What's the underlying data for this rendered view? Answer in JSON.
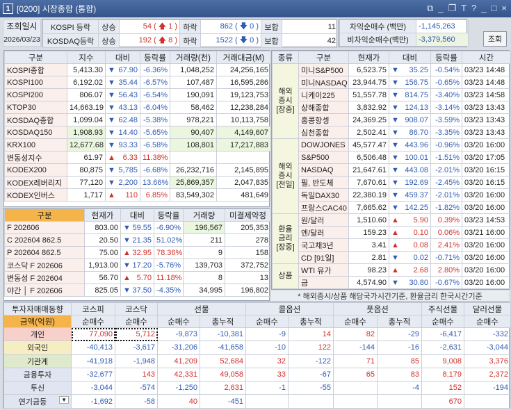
{
  "window": {
    "number": "1",
    "title": "[0200] 시장종합 (통합)",
    "icons": [
      "restore-icon",
      "minimize-icon",
      "copy-icon",
      "font-icon",
      "help-icon",
      "win-minimize-icon",
      "maximize-icon",
      "close-icon"
    ],
    "icon_glyphs": [
      "⧉",
      "_",
      "❐",
      "T",
      "?",
      "_",
      "□",
      "×"
    ]
  },
  "colors": {
    "up": "#d0312d",
    "down": "#2f5bb5",
    "header": "#e6ebf3",
    "orange": "#f5b44a",
    "title_bar": "#34538a"
  },
  "top": {
    "date_label": "조회일시",
    "date": "2026/03/23",
    "breadth": [
      {
        "market": "KOSPI 등락",
        "up_label": "상승",
        "up": "54",
        "up_chg": "1",
        "down_label": "하락",
        "down": "862",
        "down_chg": "0",
        "flat_label": "보합",
        "flat": "11"
      },
      {
        "market": "KOSDAQ등락",
        "up_label": "상승",
        "up": "192",
        "up_chg": "8",
        "down_label": "하락",
        "down": "1522",
        "down_chg": "0",
        "flat_label": "보합",
        "flat": "42"
      }
    ],
    "arbitrage": [
      {
        "label": "차익순매수  (백만)",
        "value": "-1,145,263"
      },
      {
        "label": "비차익순매수(백만)",
        "value": "-3,379,560"
      }
    ],
    "query_button": "조회"
  },
  "index_table": {
    "headers": [
      "구분",
      "지수",
      "대비",
      "등락률",
      "거래량(천)",
      "거래대금(M)"
    ],
    "rows": [
      {
        "name": "KOSPI종합",
        "value": "5,413.30",
        "dir": "dn",
        "chg": "67.90",
        "rate": "-6.36%",
        "vol": "1,048,252",
        "amt": "24,256,165"
      },
      {
        "name": "KOSPI100",
        "value": "6,192.02",
        "dir": "dn",
        "chg": "35.44",
        "rate": "-6.57%",
        "vol": "107,487",
        "amt": "16,595,286"
      },
      {
        "name": "KOSPI200",
        "value": "806.07",
        "dir": "dn",
        "chg": "56.43",
        "rate": "-6.54%",
        "vol": "190,091",
        "amt": "19,123,753"
      },
      {
        "name": "KTOP30",
        "value": "14,663.19",
        "dir": "dn",
        "chg": "43.13",
        "rate": "-6.04%",
        "vol": "58,462",
        "amt": "12,238,284"
      },
      {
        "name": "KOSDAQ종합",
        "value": "1,099.04",
        "dir": "dn",
        "chg": "62.48",
        "rate": "-5.38%",
        "vol": "978,221",
        "amt": "10,113,758"
      },
      {
        "name": "KOSDAQ150",
        "value": "1,908.93",
        "dir": "dn",
        "chg": "14.40",
        "rate": "-5.65%",
        "vol": "90,407",
        "amt": "4,149,607",
        "hl": true
      },
      {
        "name": "KRX100",
        "value": "12,677.68",
        "dir": "dn",
        "chg": "93.33",
        "rate": "-6.58%",
        "vol": "108,801",
        "amt": "17,217,883",
        "hl": true
      },
      {
        "name": "변동성지수",
        "value": "61.97",
        "dir": "up",
        "chg": "6.33",
        "rate": "11.38%",
        "vol": "",
        "amt": ""
      },
      {
        "name": "KODEX200",
        "value": "80,875",
        "dir": "dn",
        "chg": "5,785",
        "rate": "-6.68%",
        "vol": "26,232,716",
        "amt": "2,145,895"
      },
      {
        "name": "KODEX레버리지",
        "value": "77,120",
        "dir": "dn",
        "chg": "2,200",
        "rate": "13.66%",
        "vol": "25,869,357",
        "amt": "2,047,835",
        "hlvol": true
      },
      {
        "name": "KODEX인버스",
        "value": "1,717",
        "dir": "up",
        "chg": "110",
        "rate": "6.85%",
        "vol": "83,549,302",
        "amt": "481,649"
      }
    ]
  },
  "futures_table": {
    "headers": [
      "구분",
      "현재가",
      "대비",
      "등락률",
      "거래량",
      "미결제약정"
    ],
    "rows": [
      {
        "name": "F 202606",
        "value": "803.00",
        "dir": "dn",
        "chg": "59.55",
        "rate": "-6.90%",
        "vol": "196,567",
        "amt": "205,353",
        "hlvol": true
      },
      {
        "name": "C 202604    862.5",
        "value": "20.50",
        "dir": "dn",
        "chg": "21.35",
        "rate": "51.02%",
        "vol": "211",
        "amt": "278"
      },
      {
        "name": "P 202604    862.5",
        "value": "75.00",
        "dir": "up",
        "chg": "32.95",
        "rate": "78.36%",
        "vol": "9",
        "amt": "158"
      },
      {
        "name": "코스닥 F 202606",
        "value": "1,913.00",
        "dir": "dn",
        "chg": "17.20",
        "rate": "-5.76%",
        "vol": "139,703",
        "amt": "372,752"
      },
      {
        "name": "변동성 F 202604",
        "value": "56.70",
        "dir": "up",
        "chg": "5.70",
        "rate": "11.18%",
        "vol": "8",
        "amt": "13"
      },
      {
        "name": "야간 │ F 202606",
        "value": "825.05",
        "dir": "dn",
        "chg": "37.50",
        "rate": "-4.35%",
        "vol": "34,995",
        "amt": "196,802"
      }
    ]
  },
  "global_table": {
    "headers": [
      "종류",
      "구분",
      "현재가",
      "대비",
      "등락률",
      "시간"
    ],
    "groups": [
      {
        "label": "해외\n증시\n[장중]",
        "rows": [
          {
            "name": "미니S&P500",
            "value": "6,523.75",
            "dir": "dn",
            "chg": "35.25",
            "rate": "-0.54%",
            "time": "03/23 14:48"
          },
          {
            "name": "미니NASDAQ",
            "value": "23,944.75",
            "dir": "dn",
            "chg": "156.75",
            "rate": "-0.65%",
            "time": "03/23 14:48"
          },
          {
            "name": "니케이225",
            "value": "51,557.78",
            "dir": "dn",
            "chg": "814.75",
            "rate": "-3.40%",
            "time": "03/23 14:58"
          },
          {
            "name": "상해종합",
            "value": "3,832.92",
            "dir": "dn",
            "chg": "124.13",
            "rate": "-3.14%",
            "time": "03/23 13:43"
          },
          {
            "name": "홍콩항셍",
            "value": "24,369.25",
            "dir": "dn",
            "chg": "908.07",
            "rate": "-3.59%",
            "time": "03/23 13:43"
          },
          {
            "name": "심천종합",
            "value": "2,502.41",
            "dir": "dn",
            "chg": "86.70",
            "rate": "-3.35%",
            "time": "03/23 13:43"
          }
        ]
      },
      {
        "label": "해외\n증시\n[전일]",
        "rows": [
          {
            "name": "DOWJONES",
            "value": "45,577.47",
            "dir": "dn",
            "chg": "443.96",
            "rate": "-0.96%",
            "time": "03/20 16:00"
          },
          {
            "name": "S&P500",
            "value": "6,506.48",
            "dir": "dn",
            "chg": "100.01",
            "rate": "-1.51%",
            "time": "03/20 17:05"
          },
          {
            "name": "NASDAQ",
            "value": "21,647.61",
            "dir": "dn",
            "chg": "443.08",
            "rate": "-2.01%",
            "time": "03/20 16:15"
          },
          {
            "name": "필, 반도체",
            "value": "7,670.61",
            "dir": "dn",
            "chg": "192.69",
            "rate": "-2.45%",
            "time": "03/20 16:15"
          },
          {
            "name": "독일DAX30",
            "value": "22,380.19",
            "dir": "dn",
            "chg": "459.37",
            "rate": "-2.01%",
            "time": "03/20 16:00"
          },
          {
            "name": "프랑스CAC40",
            "value": "7,665.62",
            "dir": "dn",
            "chg": "142.25",
            "rate": "-1.82%",
            "time": "03/20 16:00"
          }
        ]
      },
      {
        "label": "환율\n금리\n[장중]",
        "rows": [
          {
            "name": "원/달러",
            "value": "1,510.60",
            "dir": "up",
            "chg": "5.90",
            "rate": "0.39%",
            "time": "03/23 14:53"
          },
          {
            "name": "엔/달러",
            "value": "159.23",
            "dir": "up",
            "chg": "0.10",
            "rate": "0.06%",
            "time": "03/21 16:00"
          },
          {
            "name": "국고채3년",
            "value": "3.41",
            "dir": "up",
            "chg": "0.08",
            "rate": "2.41%",
            "time": "03/20 16:00"
          },
          {
            "name": "CD [91일]",
            "value": "2.81",
            "dir": "dn",
            "chg": "0.02",
            "rate": "-0.71%",
            "time": "03/20 16:00"
          }
        ]
      },
      {
        "label": "상품",
        "rows": [
          {
            "name": "WTI 유가",
            "value": "98.23",
            "dir": "up",
            "chg": "2.68",
            "rate": "2.80%",
            "time": "03/20 16:00"
          },
          {
            "name": "금",
            "value": "4,574.90",
            "dir": "dn",
            "chg": "30.80",
            "rate": "-0.67%",
            "time": "03/20 16:00"
          }
        ]
      }
    ],
    "footnote": "* 해외증시/상품 해당국가시간기준, 환율금리 한국시간기준"
  },
  "investor_table": {
    "header_top": [
      {
        "t": "투자자매매동향",
        "c": 1
      },
      {
        "t": "코스피",
        "c": 1
      },
      {
        "t": "코스닥",
        "c": 1
      },
      {
        "t": "선물",
        "c": 2
      },
      {
        "t": "콜옵션",
        "c": 2
      },
      {
        "t": "풋옵션",
        "c": 2
      },
      {
        "t": "주식선물",
        "c": 1
      },
      {
        "t": "달러선물",
        "c": 1
      }
    ],
    "header_sub": [
      "금액(억원)",
      "순매수",
      "순매수",
      "순매수",
      "총누적",
      "순매수",
      "총누적",
      "순매수",
      "총누적",
      "순매수",
      "순매수"
    ],
    "rows": [
      {
        "name": "개인",
        "cls": "r-ind",
        "values": [
          "77,090",
          "5,712",
          "-9,873",
          "-10,381",
          "-9",
          "14",
          "82",
          "-29",
          "-6,417",
          "-332"
        ]
      },
      {
        "name": "외국인",
        "cls": "r-for",
        "values": [
          "-40,413",
          "-3,617",
          "-31,206",
          "-41,658",
          "-10",
          "122",
          "-144",
          "-16",
          "-2,631",
          "-3,044"
        ]
      },
      {
        "name": "기관계",
        "cls": "r-ins",
        "values": [
          "-41,918",
          "-1,948",
          "41,209",
          "52,684",
          "32",
          "-122",
          "71",
          "85",
          "9,008",
          "3,376"
        ]
      },
      {
        "name": "금융투자",
        "cls": "r-oth",
        "values": [
          "-32,677",
          "143",
          "42,331",
          "49,058",
          "33",
          "-67",
          "65",
          "83",
          "8,179",
          "2,372"
        ]
      },
      {
        "name": "투신",
        "cls": "r-oth",
        "values": [
          "-3,044",
          "-574",
          "-1,250",
          "2,631",
          "-1",
          "-55",
          "",
          "-4",
          "152",
          "-194"
        ]
      },
      {
        "name": "연기금등",
        "cls": "r-oth",
        "dropdown": true,
        "values": [
          "-1,692",
          "-58",
          "40",
          "-451",
          "",
          "",
          "",
          "",
          "670",
          ""
        ]
      }
    ]
  }
}
